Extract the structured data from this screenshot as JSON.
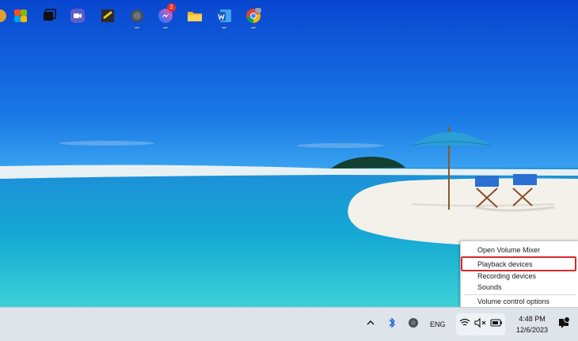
{
  "wallpaper": {
    "description_icon": "beach-wallpaper",
    "colors": {
      "sky_top": "#0a4fd6",
      "sky_bottom": "#2b93ee",
      "sea": "#0f9fcf",
      "sand": "#f2efe8"
    }
  },
  "context_menu": {
    "items": [
      {
        "label": "Open Volume Mixer"
      },
      {
        "label": "Playback devices"
      },
      {
        "label": "Recording devices"
      },
      {
        "label": "Sounds"
      },
      {
        "label": "Volume control options"
      }
    ],
    "highlight_color": "#d62b2b"
  },
  "taskbar": {
    "apps": [
      {
        "icon": "app-icon-partial"
      },
      {
        "icon": "copilot-icon"
      },
      {
        "icon": "task-view-icon"
      },
      {
        "icon": "video-call-icon"
      },
      {
        "icon": "sticky-notes-icon"
      },
      {
        "icon": "chat-app-icon"
      },
      {
        "icon": "messenger-icon",
        "badge": "2"
      },
      {
        "icon": "file-explorer-icon"
      },
      {
        "icon": "word-icon"
      },
      {
        "icon": "chrome-icon"
      }
    ],
    "tray": {
      "language": "ENG",
      "time": "4:48 PM",
      "date": "12/6/2023"
    }
  }
}
